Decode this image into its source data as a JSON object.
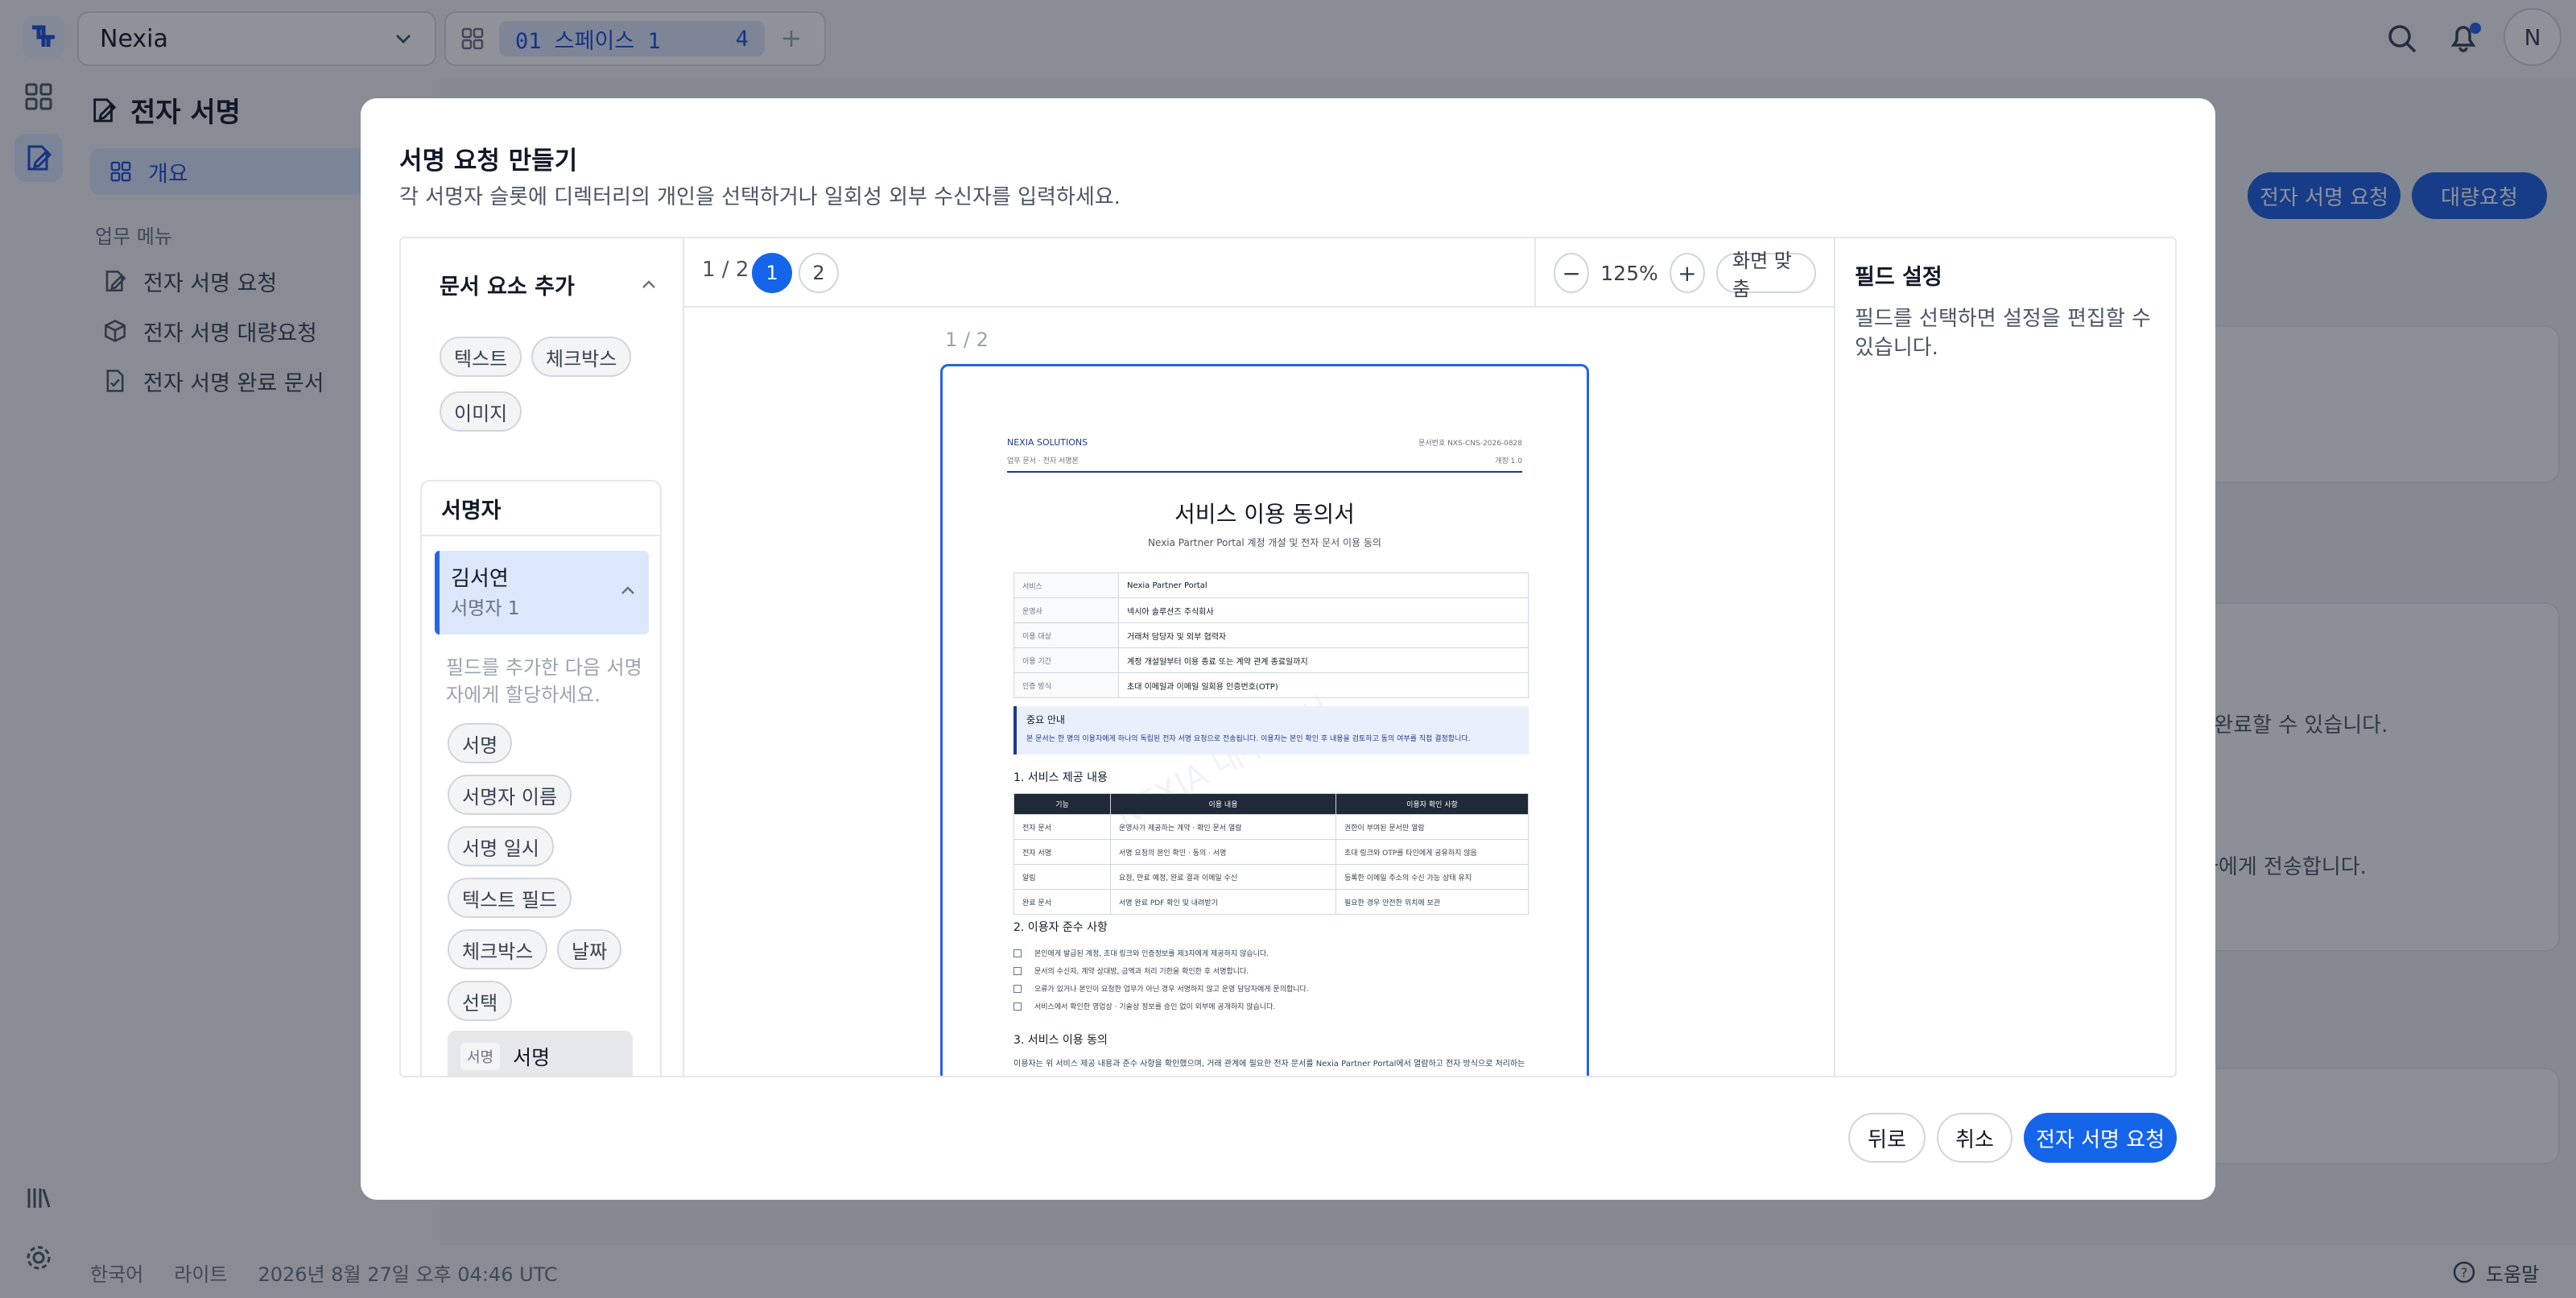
{
  "app": {
    "workspace": "Nexia",
    "space": {
      "label": "01 스페이스 1",
      "count": "4"
    },
    "avatar": "N",
    "colors": {
      "accent": "#1565ea",
      "notification": "#2563eb"
    }
  },
  "sidebar": {
    "title": "전자 서명",
    "active_item": "개요",
    "section_label": "업무 메뉴",
    "items": [
      {
        "label": "전자 서명 요청",
        "icon": "edit-doc-icon"
      },
      {
        "label": "전자 서명 대량요청",
        "icon": "cube-icon"
      },
      {
        "label": "전자 서명 완료 문서",
        "icon": "file-check-icon"
      }
    ]
  },
  "background": {
    "buttons": [
      "전자 서명 요청",
      "대량요청"
    ],
    "texts": [
      "로 완료할 수 있습니다.",
      "자에게 전송합니다."
    ]
  },
  "footer": {
    "language": "한국어",
    "theme": "라이트",
    "timestamp": "2026년 8월 27일 오후 04:46 UTC",
    "help": "도움말"
  },
  "modal": {
    "title": "서명 요청 만들기",
    "description": "각 서명자 슬롯에 디렉터리의 개인을 선택하거나 일회성 외부 수신자를 입력하세요.",
    "add_elements": {
      "title": "문서 요소 추가",
      "items": [
        "텍스트",
        "체크박스",
        "이미지"
      ]
    },
    "signers": {
      "title": "서명자",
      "signer": {
        "name": "김서연",
        "role": "서명자 1"
      },
      "hint": "필드를 추가한 다음 서명자에게 할당하세요.",
      "fields": [
        "서명",
        "서명자 이름",
        "서명 일시",
        "텍스트 필드",
        "체크박스",
        "날짜",
        "선택"
      ],
      "placed_field": {
        "tag": "서명",
        "label": "서명"
      }
    },
    "viewer": {
      "page_indicator": "1 / 2",
      "pages": [
        "1",
        "2"
      ],
      "current_page": "1",
      "zoom": "125%",
      "fit_label": "화면 맞춤",
      "page_caption": "1 / 2"
    },
    "field_settings": {
      "title": "필드 설정",
      "description": "필드를 선택하면 설정을 편집할 수 있습니다."
    },
    "buttons": {
      "back": "뒤로",
      "cancel": "취소",
      "submit": "전자 서명 요청"
    }
  },
  "document": {
    "brand": "NEXIA SOLUTIONS",
    "brand_sub": "업무 문서 · 전자 서명본",
    "doc_no": "문서번호 NXS-CNS-2026-0828",
    "version": "개정 1.0",
    "title": "서비스 이용 동의서",
    "subtitle": "Nexia Partner Portal 계정 개설 및 전자 문서 이용 동의",
    "watermark": "NEXIA 내부 문서",
    "info": [
      {
        "key": "서비스",
        "value": "Nexia Partner Portal"
      },
      {
        "key": "운영사",
        "value": "넥시아 솔루션즈 주식회사"
      },
      {
        "key": "이용 대상",
        "value": "거래처 담당자 및 외부 협력자"
      },
      {
        "key": "이용 기간",
        "value": "계정 개설일부터 이용 종료 또는 계약 관계 종료일까지"
      },
      {
        "key": "인증 방식",
        "value": "초대 이메일과 이메일 일회용 인증번호(OTP)"
      }
    ],
    "notice_title": "중요 안내",
    "notice_body": "본 문서는 한 명의 이용자에게 하나의 독립된 전자 서명 요청으로 전송됩니다. 이용자는 본인 확인 후 내용을 검토하고 동의 여부를 직접 결정합니다.",
    "section1": "1. 서비스 제공 내용",
    "table_headers": [
      "기능",
      "이용 내용",
      "이용자 확인 사항"
    ],
    "table_rows": [
      [
        "전자 문서",
        "운영사가 제공하는 계약 · 확인 문서 열람",
        "권한이 부여된 문서만 열람"
      ],
      [
        "전자 서명",
        "서명 요청의 본인 확인 · 동의 · 서명",
        "초대 링크와 OTP를 타인에게 공유하지 않음"
      ],
      [
        "알림",
        "요청, 만료 예정, 완료 결과 이메일 수신",
        "등록한 이메일 주소의 수신 가능 상태 유지"
      ],
      [
        "완료 문서",
        "서명 완료 PDF 확인 및 내려받기",
        "필요한 경우 안전한 위치에 보관"
      ]
    ],
    "section2": "2. 이용자 준수 사항",
    "checklist": [
      "본인에게 발급된 계정, 초대 링크와 인증정보를 제3자에게 제공하지 않습니다.",
      "문서의 수신자, 계약 상대방, 금액과 처리 기한을 확인한 후 서명합니다.",
      "오류가 있거나 본인이 요청한 업무가 아닌 경우 서명하지 않고 운영 담당자에게 문의합니다.",
      "서비스에서 확인한 영업상 · 기술상 정보를 승인 없이 외부에 공개하지 않습니다."
    ],
    "section3": "3. 서비스 이용 동의",
    "para": "이용자는 위 서비스 제공 내용과 준수 사항을 확인했으며, 거래 관계에 필요한 전자 문서를 Nexia Partner Portal에서 열람하고 전자 방식으로 처리하는 것에 동의합니다."
  }
}
